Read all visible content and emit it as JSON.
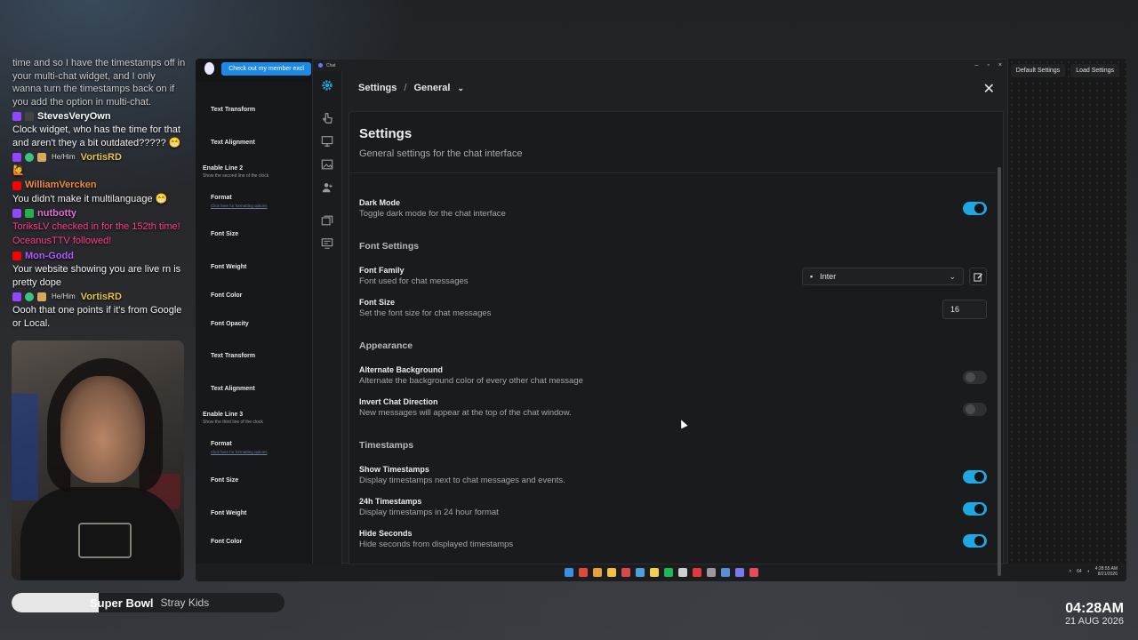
{
  "stream_chat": {
    "lines": [
      {
        "type": "text",
        "text": "time and so I have the timestamps off in your multi-chat widget, and I only wanna turn the timestamps back on if you add the option in multi-chat.",
        "faded": true
      },
      {
        "type": "user",
        "platform": "twitch",
        "user": "StevesVeryOwn",
        "color": "white",
        "pronouns": ""
      },
      {
        "type": "text",
        "text": "Clock widget, who has the time for that and aren't they a bit outdated????? 😁"
      },
      {
        "type": "user",
        "platform": "twitch",
        "user": "VortisRD",
        "color": "gold",
        "pronouns": "He/Him"
      },
      {
        "type": "emote",
        "text": "🙋"
      },
      {
        "type": "user",
        "platform": "youtube",
        "user": "WilliamVercken",
        "color": "orange",
        "pronouns": ""
      },
      {
        "type": "text",
        "text": "You didn't make it multilanguage 😁"
      },
      {
        "type": "user",
        "platform": "twitch",
        "user": "nutbotty",
        "color": "pink",
        "pronouns": ""
      },
      {
        "type": "event",
        "text": "ToriksLV checked in for the 152th time!"
      },
      {
        "type": "event",
        "text": "OceanusTTV followed!"
      },
      {
        "type": "user",
        "platform": "youtube",
        "user": "Mon-Godd",
        "color": "purple",
        "pronouns": ""
      },
      {
        "type": "text",
        "text": "Your website showing you are live rn is pretty dope"
      },
      {
        "type": "user",
        "platform": "twitch",
        "user": "VortisRD",
        "color": "gold",
        "pronouns": "He/Him"
      },
      {
        "type": "text",
        "text": "Oooh that one points if it's from Google or Local."
      }
    ]
  },
  "now_playing": {
    "song": "Super Bowl",
    "artist": "Stray Kids",
    "progress": 0.32
  },
  "clock_overlay": {
    "time": "04:28AM",
    "date": "21 AUG 2026"
  },
  "desktop": {
    "member_button": "Check out my member excl",
    "editor_items": [
      {
        "label": "Text Transform"
      },
      {
        "label": "Text Alignment"
      },
      {
        "label": "Enable Line 2",
        "sub": "Show the second line of the clock"
      },
      {
        "label": "Format",
        "link": "Click here for formatting options"
      },
      {
        "label": "Font Size"
      },
      {
        "label": "Font Weight"
      },
      {
        "label": "Font Color"
      },
      {
        "label": "Font Opacity"
      },
      {
        "label": "Text Transform"
      },
      {
        "label": "Text Alignment"
      },
      {
        "label": "Enable Line 3",
        "sub": "Show the third line of the clock"
      },
      {
        "label": "Format",
        "link": "Click here for formatting options"
      },
      {
        "label": "Font Size"
      },
      {
        "label": "Font Weight"
      },
      {
        "label": "Font Color"
      }
    ],
    "right_buttons": [
      "Default Settings",
      "Load Settings"
    ],
    "tray_time": "4:28:55 AM",
    "tray_date": "8/21/2026",
    "tray_misc": "64"
  },
  "chat_window": {
    "window_title": "Chat",
    "breadcrumb_root": "Settings",
    "breadcrumb_sep": "/",
    "breadcrumb_current": "General",
    "card_title": "Settings",
    "card_desc": "General settings for the chat interface",
    "dark_mode": {
      "label": "Dark Mode",
      "desc": "Toggle dark mode for the chat interface",
      "on": true
    },
    "font_section": "Font Settings",
    "font_family": {
      "label": "Font Family",
      "desc": "Font used for chat messages",
      "value": "Inter"
    },
    "font_size": {
      "label": "Font Size",
      "desc": "Set the font size for chat messages",
      "value": "16"
    },
    "appearance_section": "Appearance",
    "alt_bg": {
      "label": "Alternate Background",
      "desc": "Alternate the background color of every other chat message",
      "on": false
    },
    "invert_dir": {
      "label": "Invert Chat Direction",
      "desc": "New messages will appear at the top of the chat window.",
      "on": false
    },
    "timestamps_section": "Timestamps",
    "show_ts": {
      "label": "Show Timestamps",
      "desc": "Display timestamps next to chat messages and events.",
      "on": true
    },
    "ts_24h": {
      "label": "24h Timestamps",
      "desc": "Display timestamps in 24 hour format",
      "on": true
    },
    "hide_seconds": {
      "label": "Hide Seconds",
      "desc": "Hide seconds from displayed timestamps",
      "on": true
    }
  },
  "icons": {
    "rail": [
      "gear-icon",
      "hand-pointer-icon",
      "monitor-icon",
      "image-icon",
      "user-icon",
      "layers-icon",
      "display-settings-icon"
    ]
  },
  "colors": {
    "accent": "#1ea7e1",
    "bg": "#1a1b1d",
    "twitch": "#9146ff",
    "youtube": "#ff0000",
    "event": "#ff3f8a"
  }
}
